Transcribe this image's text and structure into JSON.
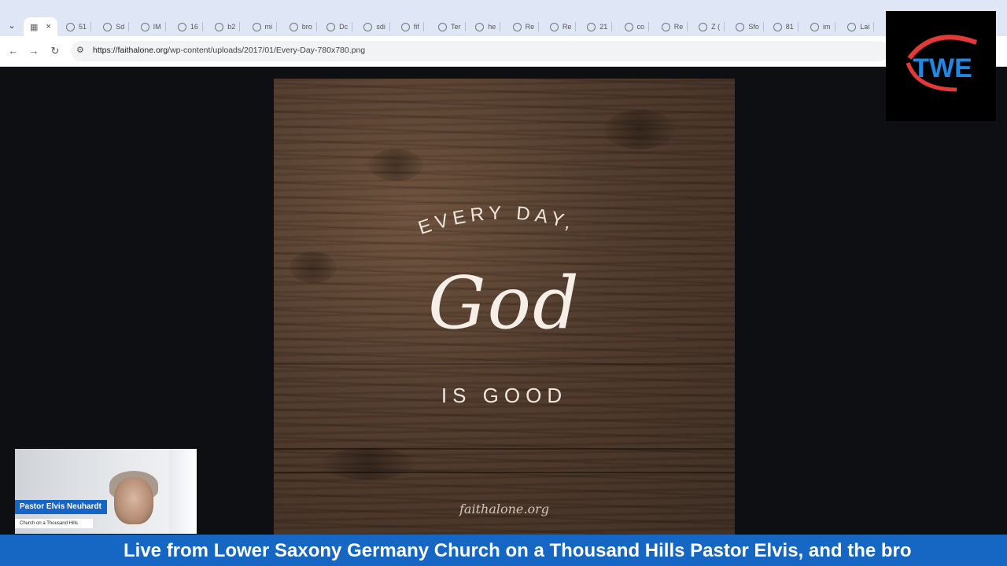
{
  "browser": {
    "active_tab": {
      "label": "",
      "close": "×"
    },
    "tabs": [
      {
        "label": "51"
      },
      {
        "label": "Sd"
      },
      {
        "label": "IM"
      },
      {
        "label": "16"
      },
      {
        "label": "b2"
      },
      {
        "label": "mi"
      },
      {
        "label": "bro"
      },
      {
        "label": "Dc"
      },
      {
        "label": "sdi"
      },
      {
        "label": "fif"
      },
      {
        "label": "Ter"
      },
      {
        "label": "he"
      },
      {
        "label": "Re"
      },
      {
        "label": "Re"
      },
      {
        "label": "21"
      },
      {
        "label": "co"
      },
      {
        "label": "Re"
      },
      {
        "label": "Z ("
      },
      {
        "label": "Sfo"
      },
      {
        "label": "81"
      },
      {
        "label": "im"
      },
      {
        "label": "Lai"
      }
    ],
    "url_host": "https://faithalone.org",
    "url_path": "/wp-content/uploads/2017/01/Every-Day-780x780.png"
  },
  "image": {
    "line1": "EVERY DAY,",
    "line2": "God",
    "line3": "IS GOOD",
    "watermark": "faithalone.org",
    "text_color": "#f5efe8"
  },
  "logo": {
    "text": "TWE",
    "colors": {
      "text": "#1e88e5",
      "swoosh": "#e53935"
    }
  },
  "presenter": {
    "name": "Pastor Elvis Neuhardt",
    "church": "Church on a Thousand Hills",
    "name_bar_color": "#1565c8"
  },
  "ticker": {
    "text": "Live from Lower Saxony Germany Church on a Thousand Hills Pastor Elvis, and the bro",
    "color": "#1666c4"
  }
}
